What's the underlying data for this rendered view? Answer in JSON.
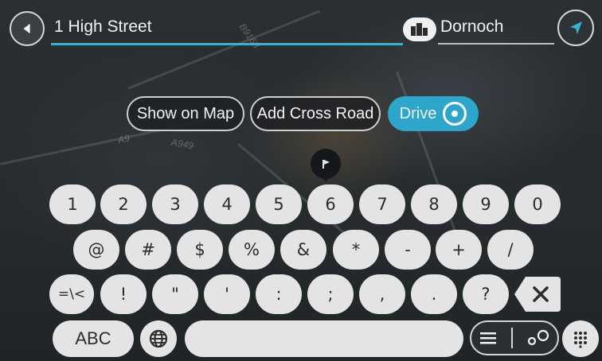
{
  "search": {
    "query": "1 High Street",
    "city": "Dornoch"
  },
  "map": {
    "labels": [
      "A9",
      "A949",
      "B9168"
    ]
  },
  "actions": {
    "show_on_map": "Show on Map",
    "add_cross_road": "Add Cross Road",
    "drive": "Drive"
  },
  "keyboard": {
    "row1": [
      "1",
      "2",
      "3",
      "4",
      "5",
      "6",
      "7",
      "8",
      "9",
      "0"
    ],
    "row2": [
      "@",
      "#",
      "$",
      "%",
      "&",
      "*",
      "-",
      "+",
      "/"
    ],
    "row3_left": "=\\<",
    "row3": [
      "!",
      "\"",
      "'",
      ":",
      ";",
      ",",
      "."
    ],
    "row3_q": "?",
    "abc": "ABC"
  },
  "icons": {
    "back": "back-arrow-icon",
    "city": "city-buildings-icon",
    "navigate": "navigation-arrow-icon",
    "drive": "steering-wheel-icon",
    "pin": "flag-pin-icon",
    "globe": "globe-icon",
    "backspace": "backspace-icon",
    "list": "list-icon",
    "map_toggle": "map-marker-icon",
    "keypad": "keypad-icon"
  },
  "colors": {
    "accent": "#2ea6cc",
    "key": "#e4e4e4"
  }
}
